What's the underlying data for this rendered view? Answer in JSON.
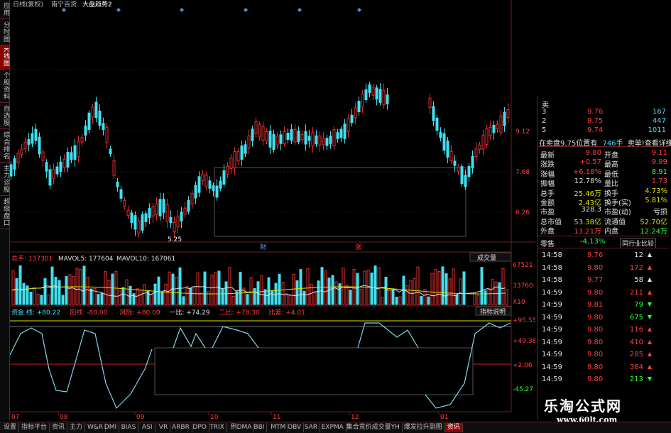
{
  "left_tabs": [
    "应用",
    "分时图",
    "K线图",
    "个股资料",
    "自选股",
    "综合排名",
    "主力诊股",
    "超级盘口"
  ],
  "active_left_tab": 2,
  "title": {
    "period": "日线(复权)",
    "stock": "南宁百货",
    "overlay": "大盘趋势2"
  },
  "price_axis": [
    "9.12",
    "7.68",
    "6.26"
  ],
  "low_label": "5.25",
  "event_markers": [
    "财",
    "涨"
  ],
  "volume_header": {
    "total": "总手: 137301",
    "ma5": "MAVOL5: 177604",
    "ma10": "MAVOL10: 167061",
    "button": "成交量"
  },
  "volume_axis": [
    "67521",
    "33760",
    "X10"
  ],
  "indicator_header": {
    "items": [
      {
        "label": "资金 线: +80.22",
        "color": "#40e0ff"
      },
      {
        "label": "阳线: -80.00",
        "color": "#ff4040"
      },
      {
        "label": "风险: +80.00",
        "color": "#ff4040"
      },
      {
        "label": "一比: +74.29",
        "color": "#e0e0e0"
      },
      {
        "label": "二比: +78.30",
        "color": "#ff4040"
      },
      {
        "label": "比差: +4.01",
        "color": "#ff4040"
      }
    ],
    "button": "指标说明"
  },
  "indicator_axis": [
    "+95.55",
    "+49.38",
    "+2.06",
    "-45.27"
  ],
  "x_axis": [
    "07",
    "08",
    "09",
    "10",
    "11",
    "12",
    "01"
  ],
  "order_book": [
    {
      "label": "卖",
      "price": "",
      "vol": ""
    },
    {
      "label": "3",
      "price": "9.76",
      "vol": "167"
    },
    {
      "label": "2",
      "price": "9.75",
      "vol": "447"
    },
    {
      "label": "5",
      "price": "9.74",
      "vol": "1011"
    }
  ],
  "order_note": {
    "left": "在卖盘9.75位置有",
    "mid": "746手",
    "right": "卖单!查看详细"
  },
  "stats": [
    {
      "l1": "最新",
      "v1": "9.80",
      "c1": "up",
      "l2": "开盘",
      "v2": "9.11",
      "c2": "up"
    },
    {
      "l1": "涨跌",
      "v1": "+0.57",
      "c1": "up",
      "l2": "最高",
      "v2": "9.99",
      "c2": "up"
    },
    {
      "l1": "涨幅",
      "v1": "+6.18%",
      "c1": "up",
      "l2": "最低",
      "v2": "8.91",
      "c2": "dn"
    },
    {
      "l1": "振幅",
      "v1": "12.78%",
      "c1": "wh",
      "l2": "量比",
      "v2": "1.73",
      "c2": "up"
    },
    {
      "l1": "总手",
      "v1": "25.46万",
      "c1": "yl",
      "l2": "换手",
      "v2": "4.73%",
      "c2": "yl"
    },
    {
      "l1": "金额",
      "v1": "2.43亿",
      "c1": "yl",
      "l2": "换手(实)",
      "v2": "5.81%",
      "c2": "yl"
    },
    {
      "l1": "市盈",
      "v1": "328.3",
      "c1": "wh",
      "l2": "市盈(动)",
      "v2": "亏损",
      "c2": "wh"
    },
    {
      "l1": "总市值",
      "v1": "53.38亿",
      "c1": "yl",
      "l2": "流通值",
      "v2": "52.70亿",
      "c2": "yl"
    },
    {
      "l1": "外盘",
      "v1": "13.21万",
      "c1": "up",
      "l2": "内盘",
      "v2": "12.24万",
      "c2": "dn"
    }
  ],
  "sector": {
    "name": "零售",
    "change": "-4.13%",
    "button": "同行业比较"
  },
  "ticks": [
    {
      "time": "14:58",
      "price": "9.76",
      "vol": "12",
      "dir": "white"
    },
    {
      "time": "14:58",
      "price": "9.80",
      "vol": "172",
      "dir": "up"
    },
    {
      "time": "14:58",
      "price": "9.77",
      "vol": "58",
      "dir": "white"
    },
    {
      "time": "14:59",
      "price": "9.80",
      "vol": "211",
      "dir": "up"
    },
    {
      "time": "14:59",
      "price": "9.81",
      "vol": "79",
      "dir": "dn"
    },
    {
      "time": "14:59",
      "price": "9.80",
      "vol": "675",
      "dir": "dn"
    },
    {
      "time": "14:59",
      "price": "9.80",
      "vol": "116",
      "dir": "up"
    },
    {
      "time": "14:59",
      "price": "9.80",
      "vol": "410",
      "dir": "up"
    },
    {
      "time": "14:59",
      "price": "9.80",
      "vol": "285",
      "dir": "up"
    },
    {
      "time": "14:59",
      "price": "9.80",
      "vol": "384",
      "dir": "up"
    },
    {
      "time": "14:59",
      "price": "9.80",
      "vol": "213",
      "dir": "dn"
    }
  ],
  "bottom_tabs": [
    "设置",
    "指标平台",
    "资讯",
    "主力",
    "W&R",
    "DMI",
    "BIAS",
    "ASI",
    "VR",
    "ARBR",
    "DPO",
    "TRIX",
    "例DMA",
    "BBI",
    "MTM",
    "OBV",
    "SAR",
    "EXPMA",
    "集合竞价成交量YH",
    "爆发拉升副图",
    "资讯"
  ],
  "active_bottom_tab": 20,
  "watermark": {
    "name": "乐淘公式网",
    "url": "www.60lt.com"
  },
  "colors": {
    "up": "#ff3030",
    "down": "#40e0f0",
    "grid": "#6a2020",
    "bg": "#000000"
  }
}
